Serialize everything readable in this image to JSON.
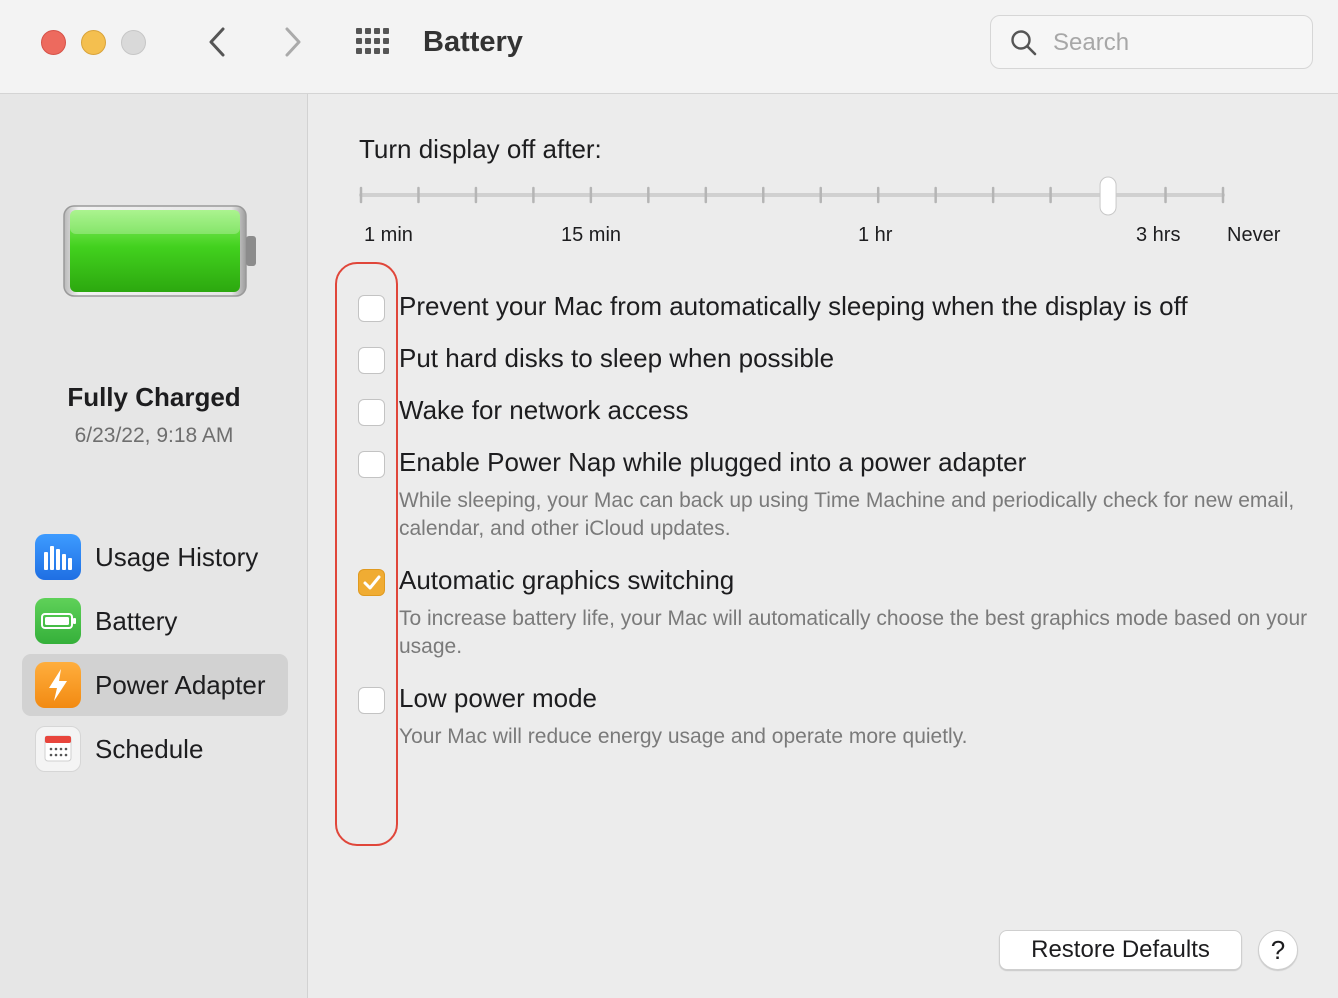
{
  "window": {
    "title": "Battery",
    "search_placeholder": "Search"
  },
  "sidebar": {
    "status_title": "Fully Charged",
    "status_time": "6/23/22, 9:18 AM",
    "items": [
      {
        "label": "Usage History",
        "icon": "usage-history-icon",
        "selected": false
      },
      {
        "label": "Battery",
        "icon": "battery-icon",
        "selected": false
      },
      {
        "label": "Power Adapter",
        "icon": "power-adapter-icon",
        "selected": true
      },
      {
        "label": "Schedule",
        "icon": "schedule-icon",
        "selected": false
      }
    ]
  },
  "display_slider": {
    "title": "Turn display off after:",
    "tick_labels": [
      "1 min",
      "15 min",
      "1 hr",
      "3 hrs",
      "Never"
    ],
    "tick_count": 16,
    "selected_tick_index": 13
  },
  "options": [
    {
      "label": "Prevent your Mac from automatically sleeping when the display is off",
      "checked": false,
      "description": ""
    },
    {
      "label": "Put hard disks to sleep when possible",
      "checked": false,
      "description": ""
    },
    {
      "label": "Wake for network access",
      "checked": false,
      "description": ""
    },
    {
      "label": "Enable Power Nap while plugged into a power adapter",
      "checked": false,
      "description": "While sleeping, your Mac can back up using Time Machine and periodically check for new email, calendar, and other iCloud updates."
    },
    {
      "label": "Automatic graphics switching",
      "checked": true,
      "description": "To increase battery life, your Mac will automatically choose the best graphics mode based on your usage."
    },
    {
      "label": "Low power mode",
      "checked": false,
      "description": "Your Mac will reduce energy usage and operate more quietly."
    }
  ],
  "footer": {
    "restore_label": "Restore Defaults",
    "help_label": "?"
  },
  "colors": {
    "accent_checkbox": "#f0ac33",
    "highlight_annotation": "#e0463a",
    "battery_fill": "#3fcf1f"
  }
}
